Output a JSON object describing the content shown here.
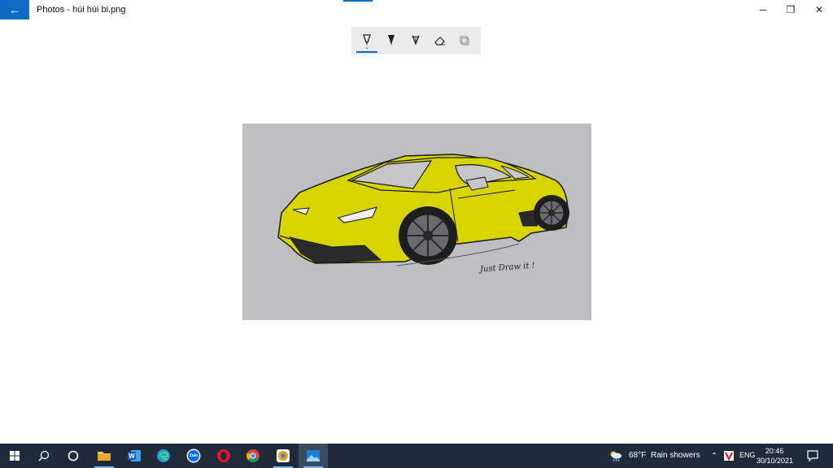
{
  "window": {
    "title": "Photos - húi húi bi.png",
    "back_icon": "back-arrow-icon",
    "controls": {
      "minimize": "─",
      "maximize": "❐",
      "close": "✕"
    },
    "accent": "#0a6cc2"
  },
  "toolbar": {
    "tools": [
      {
        "name": "ballpoint-pen",
        "active": true
      },
      {
        "name": "pencil",
        "active": false
      },
      {
        "name": "calligraphy-pen",
        "active": false
      },
      {
        "name": "eraser",
        "active": false
      },
      {
        "name": "crop",
        "active": false
      }
    ]
  },
  "image": {
    "signature": "Just Draw it !"
  },
  "taskbar": {
    "background": "#1f2b3a",
    "apps": [
      "start",
      "search",
      "task-view",
      "file-explorer",
      "word",
      "edge",
      "zalo",
      "opera",
      "chrome",
      "chrome-canary",
      "photos"
    ],
    "zalo_label": "Zalo",
    "weather": {
      "temp": "68°F",
      "condition": "Rain showers"
    },
    "language": "ENG",
    "clock": {
      "time": "20:46",
      "date": "30/10/2021"
    }
  }
}
